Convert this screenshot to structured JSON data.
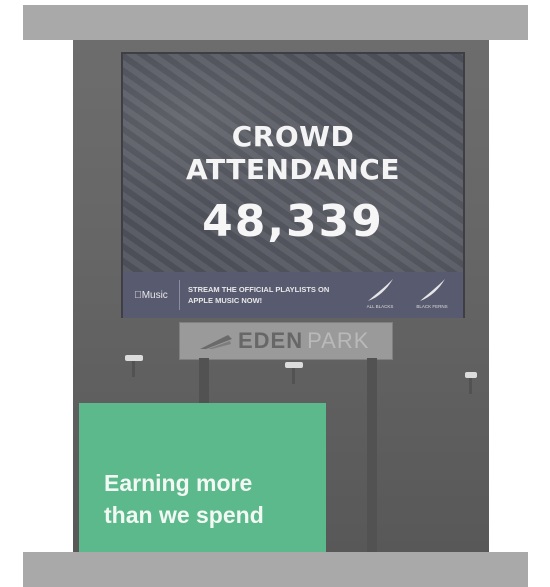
{
  "scoreboard": {
    "title": "CROWD ATTENDANCE",
    "attendance": "48,339",
    "sponsor_logo": "Music",
    "sponsor_message": "STREAM THE OFFICIAL PLAYLISTS ON APPLE MUSIC NOW!",
    "team_badges": [
      "ALL BLACKS",
      "BLACK FERNS"
    ]
  },
  "stadium_sign": {
    "name_dark": "EDEN",
    "name_light": "PARK"
  },
  "caption": {
    "line1": "Earning more",
    "line2": "than we spend"
  },
  "colors": {
    "frame_bars": "#a9a9a9",
    "caption_background": "#5cb98b",
    "caption_text": "#f2f8f4"
  }
}
